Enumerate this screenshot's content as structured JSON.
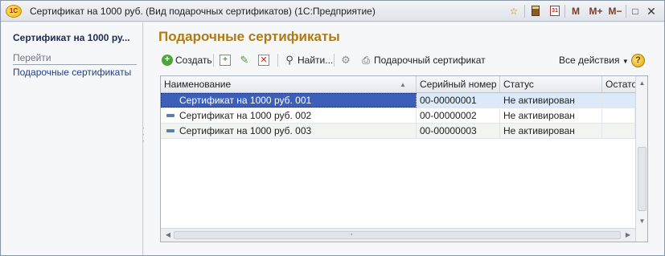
{
  "window": {
    "title": "Сертификат на 1000 руб. (Вид подарочных сертификатов)  (1С:Предприятие)",
    "logo": "1С",
    "buttons": {
      "m": "M",
      "m_plus": "M+",
      "m_minus": "M−",
      "restore": "□",
      "close": "✕",
      "calendar_day": "31"
    },
    "icons": [
      "star-icon",
      "calculator-icon",
      "calendar-icon",
      "restore-icon",
      "close-icon"
    ]
  },
  "sidebar": {
    "title": "Сертификат на 1000 ру...",
    "section": "Перейти",
    "links": [
      {
        "label": "Подарочные сертификаты"
      }
    ]
  },
  "main": {
    "title": "Подарочные сертификаты",
    "toolbar": {
      "create": "Создать",
      "find": "Найти...",
      "print_gift": "Подарочный сертификат",
      "all_actions": "Все действия",
      "help": "?"
    },
    "table": {
      "columns": [
        "Наименование",
        "Серийный номер",
        "Статус",
        "Остаток"
      ],
      "rows": [
        {
          "name": "Сертификат на 1000 руб. 001",
          "serial": "00-00000001",
          "status": "Не активирован",
          "rest": ""
        },
        {
          "name": "Сертификат на 1000 руб. 002",
          "serial": "00-00000002",
          "status": "Не активирован",
          "rest": ""
        },
        {
          "name": "Сертификат на 1000 руб. 003",
          "serial": "00-00000003",
          "status": "Не активирован",
          "rest": ""
        }
      ],
      "selected_row": 0
    }
  },
  "colors": {
    "title_accent": "#b07a12",
    "selection": "#3d5fb8",
    "link": "#1f3f8f",
    "create_green": "#4aa63a",
    "delete_red": "#d0201a"
  }
}
